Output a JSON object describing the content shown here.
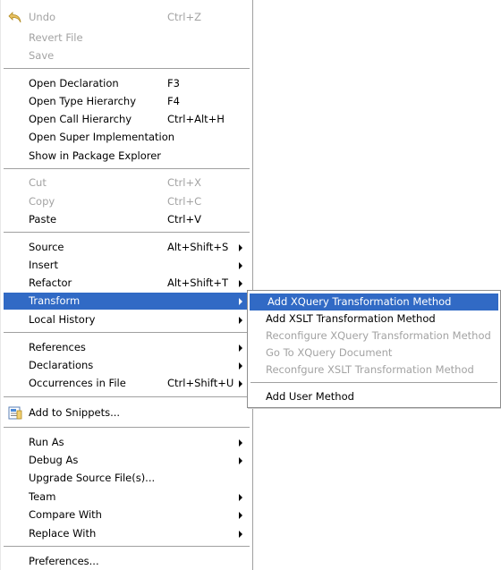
{
  "main_menu": {
    "undo": {
      "label": "Undo",
      "accel": "Ctrl+Z",
      "icon": "undo-icon"
    },
    "revert_file": {
      "label": "Revert File"
    },
    "save": {
      "label": "Save"
    },
    "open_declaration": {
      "label": "Open Declaration",
      "accel": "F3"
    },
    "open_type_hierarchy": {
      "label": "Open Type Hierarchy",
      "accel": "F4"
    },
    "open_call_hierarchy": {
      "label": "Open Call Hierarchy",
      "accel": "Ctrl+Alt+H"
    },
    "open_super_impl": {
      "label": "Open Super Implementation"
    },
    "show_in_package": {
      "label": "Show in Package Explorer"
    },
    "cut": {
      "label": "Cut",
      "accel": "Ctrl+X"
    },
    "copy": {
      "label": "Copy",
      "accel": "Ctrl+C"
    },
    "paste": {
      "label": "Paste",
      "accel": "Ctrl+V"
    },
    "source": {
      "label": "Source",
      "accel": "Alt+Shift+S"
    },
    "insert": {
      "label": "Insert"
    },
    "refactor": {
      "label": "Refactor",
      "accel": "Alt+Shift+T"
    },
    "transform": {
      "label": "Transform"
    },
    "local_history": {
      "label": "Local History"
    },
    "references": {
      "label": "References"
    },
    "declarations": {
      "label": "Declarations"
    },
    "occurrences": {
      "label": "Occurrences in File",
      "accel": "Ctrl+Shift+U"
    },
    "add_snippets": {
      "label": "Add to Snippets...",
      "icon": "snippets-icon"
    },
    "run_as": {
      "label": "Run As"
    },
    "debug_as": {
      "label": "Debug As"
    },
    "upgrade_source": {
      "label": "Upgrade Source File(s)..."
    },
    "team": {
      "label": "Team"
    },
    "compare_with": {
      "label": "Compare With"
    },
    "replace_with": {
      "label": "Replace With"
    },
    "preferences": {
      "label": "Preferences..."
    }
  },
  "transform_submenu": {
    "add_xquery": {
      "label": "Add XQuery Transformation Method"
    },
    "add_xslt": {
      "label": "Add XSLT Transformation Method"
    },
    "reconfigure_xquery": {
      "label": "Reconfigure XQuery Transformation Method"
    },
    "goto_xquery": {
      "label": "Go To XQuery Document"
    },
    "reconfigure_xslt": {
      "label": "Reconfgure XSLT Transformation Method"
    },
    "add_user_method": {
      "label": "Add User Method"
    }
  },
  "colors": {
    "highlight": "#316ac5",
    "disabled_text": "#a3a3a3"
  }
}
